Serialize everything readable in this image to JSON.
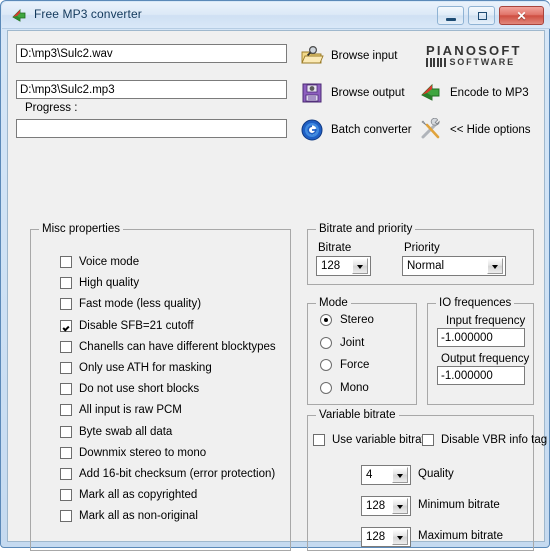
{
  "window": {
    "title": "Free MP3 converter",
    "icon": "mp3-convert-icon",
    "buttons": {
      "minimize": "minimize-button",
      "maximize": "maximize-button",
      "close_glyph": "✕"
    }
  },
  "top": {
    "input_file": "D:\\mp3\\Sulc2.wav",
    "output_file": "D:\\mp3\\Sulc2.mp3",
    "progress_label": "Progress :",
    "progress_value": "",
    "actions": [
      {
        "id": "browse-input",
        "label": "Browse input",
        "icon": "folder-search-icon"
      },
      {
        "id": "browse-output",
        "label": "Browse output",
        "icon": "save-disk-icon"
      },
      {
        "id": "batch",
        "label": "Batch converter",
        "icon": "batch-circle-icon"
      },
      {
        "id": "encode",
        "label": "Encode to MP3",
        "icon": "encode-arrow-icon"
      },
      {
        "id": "hide-options",
        "label": "<< Hide options",
        "icon": "tools-icon"
      }
    ],
    "logo": {
      "name": "PIANOSOFT",
      "sub": "SOFTWARE"
    }
  },
  "misc": {
    "title": "Misc properties",
    "items": [
      {
        "label": "Voice mode",
        "checked": false
      },
      {
        "label": "High quality",
        "checked": false
      },
      {
        "label": "Fast mode (less quality)",
        "checked": false
      },
      {
        "label": "Disable SFB=21 cutoff",
        "checked": true
      },
      {
        "label": "Chanells can have different blocktypes",
        "checked": false
      },
      {
        "label": "Only use ATH for masking",
        "checked": false
      },
      {
        "label": "Do not use short blocks",
        "checked": false
      },
      {
        "label": "All input is raw PCM",
        "checked": false
      },
      {
        "label": "Byte swab all data",
        "checked": false
      },
      {
        "label": "Downmix stereo to mono",
        "checked": false
      },
      {
        "label": "Add 16-bit checksum (error protection)",
        "checked": false
      },
      {
        "label": "Mark all as copyrighted",
        "checked": false
      },
      {
        "label": "Mark all as non-original",
        "checked": false
      }
    ]
  },
  "bitrate_priority": {
    "title": "Bitrate and priority",
    "bitrate_label": "Bitrate",
    "bitrate_value": "128",
    "priority_label": "Priority",
    "priority_value": "Normal"
  },
  "mode": {
    "title": "Mode",
    "options": [
      {
        "label": "Stereo",
        "selected": true
      },
      {
        "label": "Joint",
        "selected": false
      },
      {
        "label": "Force",
        "selected": false
      },
      {
        "label": "Mono",
        "selected": false
      }
    ]
  },
  "io_frequences": {
    "title": "IO frequences",
    "input_label": "Input frequency",
    "input_value": "-1.000000",
    "output_label": "Output frequency",
    "output_value": "-1.000000"
  },
  "variable_bitrate": {
    "title": "Variable bitrate",
    "use_vbr_label": "Use variable bitrate",
    "use_vbr_checked": false,
    "disable_tag_label": "Disable VBR info tag",
    "disable_tag_checked": false,
    "rows": [
      {
        "value": "4",
        "label": "Quality"
      },
      {
        "value": "128",
        "label": "Minimum bitrate"
      },
      {
        "value": "128",
        "label": "Maximum bitrate"
      }
    ]
  },
  "colors": {
    "window_frame": "#5b89b8",
    "client_bg": "#f0f0f0",
    "close_button": "#cf4e41",
    "title_text": "#12395c"
  }
}
